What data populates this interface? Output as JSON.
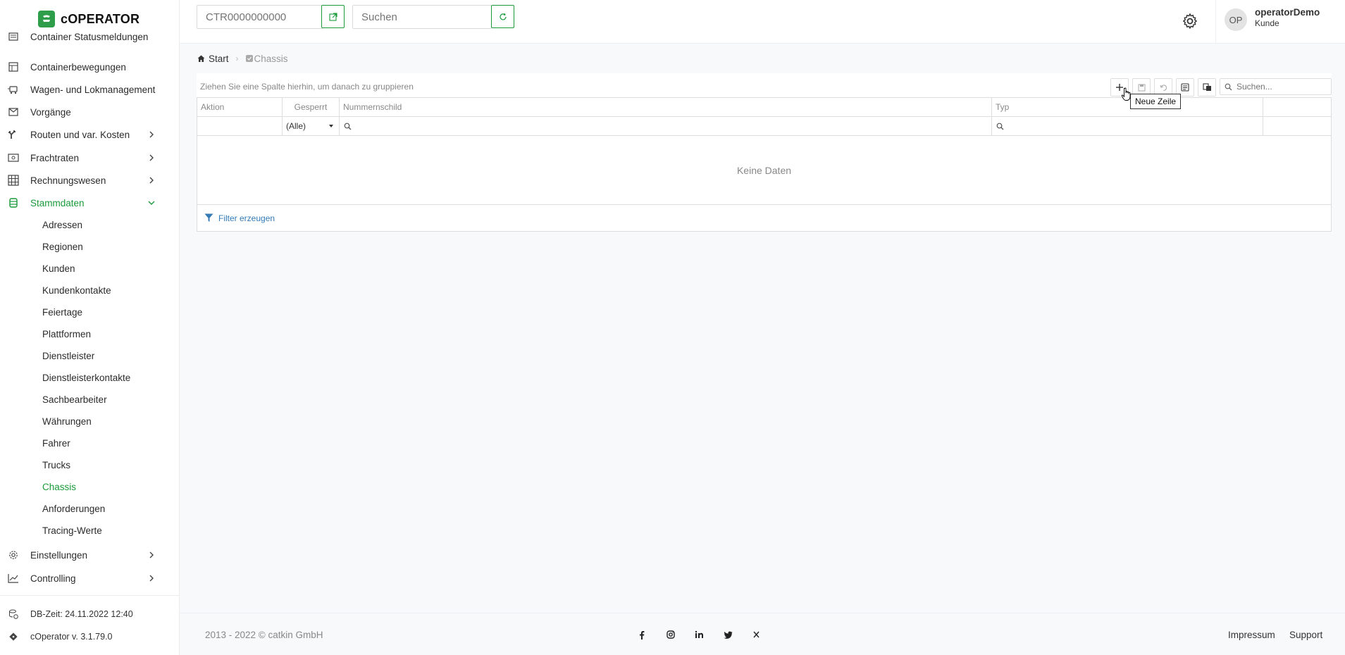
{
  "app": {
    "logo_text": "cOPERATOR"
  },
  "header": {
    "container_input_placeholder": "CTR0000000000",
    "search_placeholder": "Suchen",
    "user_initials": "OP",
    "user_name": "operatorDemo",
    "user_role": "Kunde"
  },
  "sidebar": {
    "items": [
      {
        "label": "Container Statusmeldungen",
        "icon": "status-list-icon"
      },
      {
        "label": "Containerbewegungen",
        "icon": "table-icon"
      },
      {
        "label": "Wagen- und Lokmanagement",
        "icon": "train-icon"
      },
      {
        "label": "Vorgänge",
        "icon": "mail-icon"
      },
      {
        "label": "Routen und var. Kosten",
        "icon": "route-icon",
        "expandable": true
      },
      {
        "label": "Frachtraten",
        "icon": "cash-icon",
        "expandable": true
      },
      {
        "label": "Rechnungswesen",
        "icon": "grid-icon",
        "expandable": true
      },
      {
        "label": "Stammdaten",
        "icon": "database-icon",
        "expandable": true,
        "expanded": true
      }
    ],
    "subitems": [
      "Adressen",
      "Regionen",
      "Kunden",
      "Kundenkontakte",
      "Feiertage",
      "Plattformen",
      "Dienstleister",
      "Dienstleisterkontakte",
      "Sachbearbeiter",
      "Währungen",
      "Fahrer",
      "Trucks",
      "Chassis",
      "Anforderungen",
      "Tracing-Werte"
    ],
    "current_subitem": "Chassis",
    "bottom_items": [
      {
        "label": "Einstellungen",
        "icon": "settings-icon"
      },
      {
        "label": "Controlling",
        "icon": "chart-line-icon"
      }
    ],
    "db_time": "DB-Zeit: 24.11.2022 12:40",
    "version": "cOperator v. 3.1.79.0"
  },
  "breadcrumb": {
    "home": "Start",
    "current": "Chassis"
  },
  "grid": {
    "group_hint": "Ziehen Sie eine Spalte hierhin, um danach zu gruppieren",
    "search_placeholder": "Suchen...",
    "tooltip": "Neue Zeile",
    "columns": [
      "Aktion",
      "Gesperrt",
      "Nummernschild",
      "Typ",
      ""
    ],
    "filter_gesperrt_value": "(Alle)",
    "no_data": "Keine Daten",
    "filter_build": "Filter erzeugen"
  },
  "footer": {
    "copyright": "2013 - 2022 © catkin GmbH",
    "social_icons": [
      "facebook-icon",
      "instagram-icon",
      "linkedin-icon",
      "twitter-icon",
      "xing-icon"
    ],
    "links": [
      "Impressum",
      "Support"
    ]
  },
  "colors": {
    "accent": "#1a9a3a",
    "link": "#337ab7",
    "background": "#f8f9fb"
  }
}
